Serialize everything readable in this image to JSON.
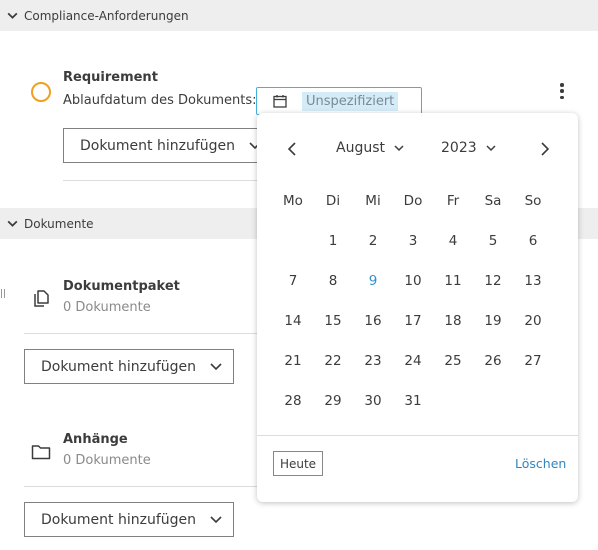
{
  "sections": {
    "compliance": {
      "label": "Compliance-Anforderungen"
    },
    "documents": {
      "label": "Dokumente"
    }
  },
  "requirement": {
    "title": "Requirement",
    "date_label": "Ablaufdatum des Dokuments:",
    "date_value": "Unspezifiziert",
    "status_color": "#f0a020",
    "add_document_label": "Dokument hinzufügen"
  },
  "document_groups": [
    {
      "title": "Dokumentpaket",
      "count_text": "0 Dokumente",
      "icon": "document-stack-icon",
      "add_document_label": "Dokument hinzufügen"
    },
    {
      "title": "Anhänge",
      "count_text": "0 Dokumente",
      "icon": "folder-icon",
      "add_document_label": "Dokument hinzufügen"
    }
  ],
  "datepicker": {
    "month": "August",
    "year": "2023",
    "weekdays": [
      "Mo",
      "Di",
      "Mi",
      "Do",
      "Fr",
      "Sa",
      "So"
    ],
    "weeks": [
      [
        "",
        "1",
        "2",
        "3",
        "4",
        "5",
        "6"
      ],
      [
        "7",
        "8",
        "9",
        "10",
        "11",
        "12",
        "13"
      ],
      [
        "14",
        "15",
        "16",
        "17",
        "18",
        "19",
        "20"
      ],
      [
        "21",
        "22",
        "23",
        "24",
        "25",
        "26",
        "27"
      ],
      [
        "28",
        "29",
        "30",
        "31",
        "",
        "",
        ""
      ]
    ],
    "today": "9",
    "today_button": "Heute",
    "clear_link": "Löschen",
    "accent_color": "#3391c9"
  }
}
